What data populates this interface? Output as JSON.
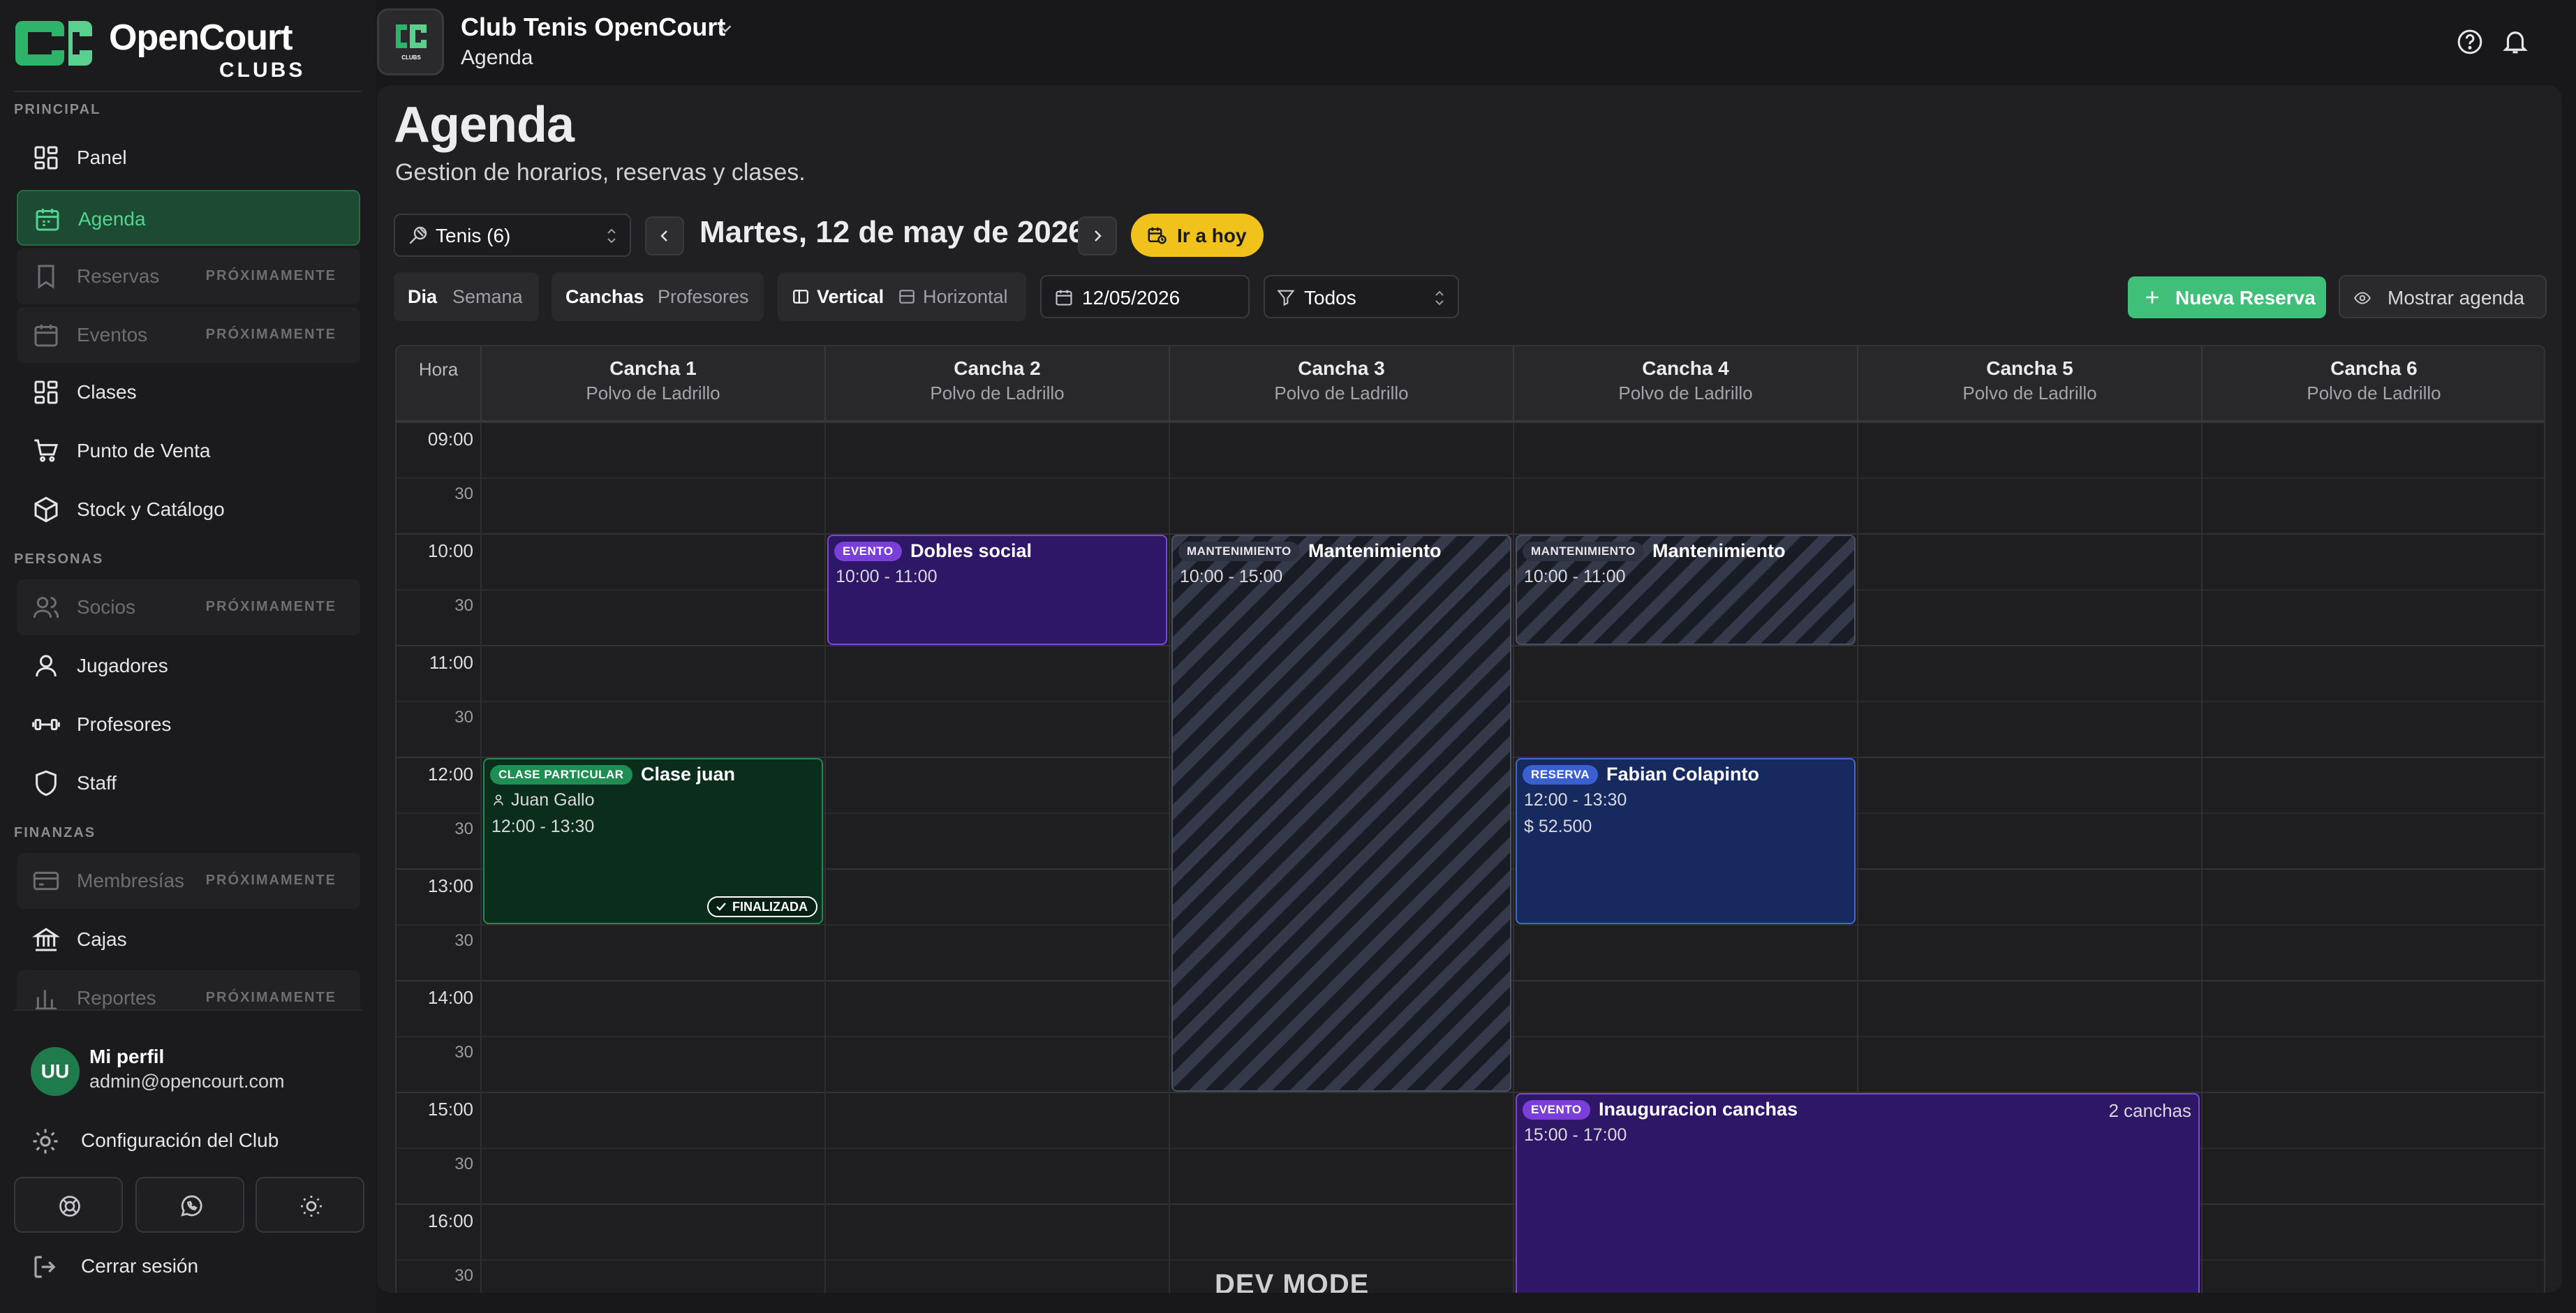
{
  "brand": {
    "name": "OpenCourt",
    "sub": "CLUBS"
  },
  "sidebar": {
    "sections": {
      "principal": "PRINCIPAL",
      "personas": "PERSONAS",
      "finanzas": "FINANZAS"
    },
    "items": [
      {
        "label": "Panel",
        "icon": "dashboard-icon"
      },
      {
        "label": "Agenda",
        "icon": "calendar-icon",
        "active": true
      },
      {
        "label": "Reservas",
        "icon": "bookmark-icon",
        "soon": "PRÓXIMAMENTE"
      },
      {
        "label": "Eventos",
        "icon": "calendar-icon",
        "soon": "PRÓXIMAMENTE"
      },
      {
        "label": "Clases",
        "icon": "dashboard-icon"
      },
      {
        "label": "Punto de Venta",
        "icon": "cart-icon"
      },
      {
        "label": "Stock y Catálogo",
        "icon": "package-icon"
      },
      {
        "label": "Socios",
        "icon": "users-icon",
        "soon": "PRÓXIMAMENTE"
      },
      {
        "label": "Jugadores",
        "icon": "user-icon"
      },
      {
        "label": "Profesores",
        "icon": "dumbbell-icon"
      },
      {
        "label": "Staff",
        "icon": "shield-icon"
      },
      {
        "label": "Membresías",
        "icon": "card-icon",
        "soon": "PRÓXIMAMENTE"
      },
      {
        "label": "Cajas",
        "icon": "bank-icon"
      },
      {
        "label": "Reportes",
        "icon": "chart-icon",
        "soon": "PRÓXIMAMENTE"
      }
    ],
    "profile": {
      "initials": "UU",
      "name": "Mi perfil",
      "email": "admin@opencourt.com"
    },
    "config_label": "Configuración del Club",
    "logout_label": "Cerrar sesión"
  },
  "header": {
    "club_name": "Club Tenis OpenCourt",
    "crumb": "Agenda",
    "logo_sub": "CLUBS"
  },
  "page": {
    "title": "Agenda",
    "subtitle": "Gestion de horarios, reservas y clases.",
    "sport_select": "Tenis (6)",
    "date_title": "Martes, 12 de may de 2026",
    "today_label": "Ir a hoy",
    "view_day": "Dia",
    "view_week": "Semana",
    "group_courts": "Canchas",
    "group_teachers": "Profesores",
    "orient_vertical": "Vertical",
    "orient_horizontal": "Horizontal",
    "date_input": "12/05/2026",
    "filter_select": "Todos",
    "new_booking": "Nueva Reserva",
    "show_agenda": "Mostrar agenda"
  },
  "calendar": {
    "hour_header": "Hora",
    "courts": [
      {
        "name": "Cancha 1",
        "surface": "Polvo de Ladrillo"
      },
      {
        "name": "Cancha 2",
        "surface": "Polvo de Ladrillo"
      },
      {
        "name": "Cancha 3",
        "surface": "Polvo de Ladrillo"
      },
      {
        "name": "Cancha 4",
        "surface": "Polvo de Ladrillo"
      },
      {
        "name": "Cancha 5",
        "surface": "Polvo de Ladrillo"
      },
      {
        "name": "Cancha 6",
        "surface": "Polvo de Ladrillo"
      }
    ],
    "times": [
      "09:00",
      "30",
      "10:00",
      "30",
      "11:00",
      "30",
      "12:00",
      "30",
      "13:00",
      "30",
      "14:00",
      "30",
      "15:00",
      "30",
      "16:00",
      "30"
    ],
    "events": [
      {
        "kind": "purple",
        "tag": "EVENTO",
        "title": "Dobles social",
        "time": "10:00 - 11:00",
        "court": 2,
        "court_span": 1,
        "start": "10:00",
        "end": "11:00"
      },
      {
        "kind": "maint",
        "tag": "MANTENIMIENTO",
        "title": "Mantenimiento",
        "time": "10:00 - 15:00",
        "court": 3,
        "court_span": 1,
        "start": "10:00",
        "end": "15:00"
      },
      {
        "kind": "maint",
        "tag": "MANTENIMIENTO",
        "title": "Mantenimiento",
        "time": "10:00 - 11:00",
        "court": 4,
        "court_span": 1,
        "start": "10:00",
        "end": "11:00"
      },
      {
        "kind": "green",
        "tag": "CLASE PARTICULAR",
        "title": "Clase juan",
        "person": "Juan Gallo",
        "time": "12:00 - 13:30",
        "status": "FINALIZADA",
        "court": 1,
        "court_span": 1,
        "start": "12:00",
        "end": "13:30"
      },
      {
        "kind": "blue",
        "tag": "RESERVA",
        "title": "Fabian Colapinto",
        "time": "12:00 - 13:30",
        "price": "$ 52.500",
        "court": 4,
        "court_span": 1,
        "start": "12:00",
        "end": "13:30"
      },
      {
        "kind": "purple",
        "tag": "EVENTO",
        "title": "Inauguracion canchas",
        "time": "15:00 - 17:00",
        "count": "2 canchas",
        "court": 4,
        "court_span": 2,
        "start": "15:00",
        "end": "17:00"
      }
    ]
  },
  "dev_mode": "DEV MODE"
}
